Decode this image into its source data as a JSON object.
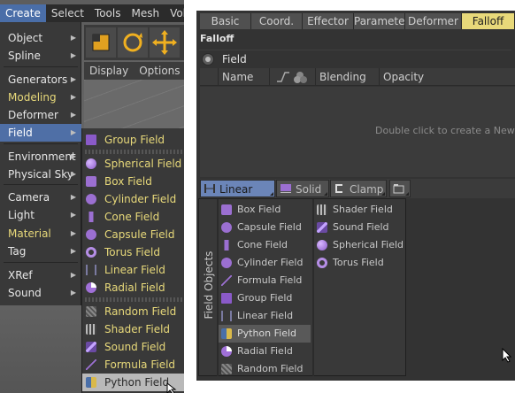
{
  "menubar": {
    "items": [
      "Create",
      "Select",
      "Tools",
      "Mesh",
      "Volu"
    ]
  },
  "view_menu": {
    "items": [
      "Display",
      "Options",
      "F"
    ]
  },
  "main_menu": {
    "items": [
      {
        "label": "Object",
        "color": "white",
        "arrow": true
      },
      {
        "label": "Spline",
        "color": "white",
        "arrow": true
      },
      {
        "label": "Generators",
        "color": "white",
        "arrow": true
      },
      {
        "label": "Modeling",
        "color": "yellow",
        "arrow": true
      },
      {
        "label": "Deformer",
        "color": "white",
        "arrow": true
      },
      {
        "label": "Field",
        "color": "white",
        "arrow": true,
        "selected": true
      },
      {
        "label": "Environment",
        "color": "white",
        "arrow": true
      },
      {
        "label": "Physical Sky",
        "color": "white",
        "arrow": true
      },
      {
        "label": "Camera",
        "color": "white",
        "arrow": true
      },
      {
        "label": "Light",
        "color": "white",
        "arrow": true
      },
      {
        "label": "Material",
        "color": "yellow",
        "arrow": true
      },
      {
        "label": "Tag",
        "color": "white",
        "arrow": true
      },
      {
        "label": "XRef",
        "color": "white",
        "arrow": true
      },
      {
        "label": "Sound",
        "color": "white",
        "arrow": true
      }
    ]
  },
  "field_submenu": {
    "items": [
      {
        "label": "Group Field",
        "icon": "group-field-icon"
      },
      {
        "label": "Spherical Field",
        "icon": "spherical-field-icon"
      },
      {
        "label": "Box Field",
        "icon": "box-field-icon"
      },
      {
        "label": "Cylinder Field",
        "icon": "cylinder-field-icon"
      },
      {
        "label": "Cone Field",
        "icon": "cone-field-icon"
      },
      {
        "label": "Capsule Field",
        "icon": "capsule-field-icon"
      },
      {
        "label": "Torus Field",
        "icon": "torus-field-icon"
      },
      {
        "label": "Linear Field",
        "icon": "linear-field-icon"
      },
      {
        "label": "Radial Field",
        "icon": "radial-field-icon"
      },
      {
        "label": "Random Field",
        "icon": "random-field-icon"
      },
      {
        "label": "Shader Field",
        "icon": "shader-field-icon"
      },
      {
        "label": "Sound Field",
        "icon": "sound-field-icon"
      },
      {
        "label": "Formula Field",
        "icon": "formula-field-icon"
      },
      {
        "label": "Python Field",
        "icon": "python-field-icon",
        "highlighted": true
      }
    ]
  },
  "attribute_tabs": {
    "items": [
      "Basic",
      "Coord.",
      "Effector",
      "Parameter",
      "Deformer",
      "Falloff"
    ],
    "active": "Falloff"
  },
  "falloff": {
    "section_title": "Falloff",
    "field_radio_label": "Field",
    "list_columns": {
      "name": "Name",
      "blending": "Blending",
      "opacity": "Opacity"
    },
    "empty_hint": "Double click to create a New Fi"
  },
  "field_toolbar": {
    "linear": "Linear Field",
    "solid": "Solid",
    "clamp": "Clamp"
  },
  "field_objects_popup": {
    "title": "Field Objects",
    "col1": [
      {
        "label": "Box Field",
        "icon": "box-field-icon"
      },
      {
        "label": "Capsule Field",
        "icon": "capsule-field-icon"
      },
      {
        "label": "Cone Field",
        "icon": "cone-field-icon"
      },
      {
        "label": "Cylinder Field",
        "icon": "cylinder-field-icon"
      },
      {
        "label": "Formula Field",
        "icon": "formula-field-icon"
      },
      {
        "label": "Group Field",
        "icon": "group-field-icon"
      },
      {
        "label": "Linear Field",
        "icon": "linear-field-icon"
      },
      {
        "label": "Python Field",
        "icon": "python-field-icon",
        "highlighted": true
      },
      {
        "label": "Radial Field",
        "icon": "radial-field-icon"
      },
      {
        "label": "Random Field",
        "icon": "random-field-icon"
      }
    ],
    "col2": [
      {
        "label": "Shader Field",
        "icon": "shader-field-icon"
      },
      {
        "label": "Sound Field",
        "icon": "sound-field-icon"
      },
      {
        "label": "Spherical Field",
        "icon": "spherical-field-icon"
      },
      {
        "label": "Torus Field",
        "icon": "torus-field-icon"
      }
    ]
  },
  "colors": {
    "menu_highlight": "#4f6fa6",
    "yellow_text": "#e8d97a",
    "active_tab": "#e8d97a"
  }
}
